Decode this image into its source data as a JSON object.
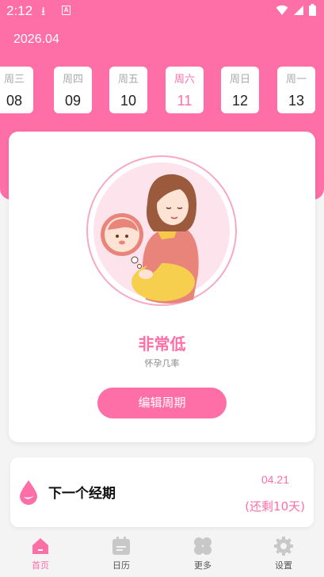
{
  "status_bar": {
    "time": "2:12"
  },
  "header": {
    "month": "2026.04"
  },
  "week": [
    {
      "name": "周三",
      "day": "08",
      "selected": false
    },
    {
      "name": "周四",
      "day": "09",
      "selected": false
    },
    {
      "name": "周五",
      "day": "10",
      "selected": false
    },
    {
      "name": "周六",
      "day": "11",
      "selected": true
    },
    {
      "name": "周日",
      "day": "12",
      "selected": false
    },
    {
      "name": "周一",
      "day": "13",
      "selected": false
    }
  ],
  "main": {
    "level": "非常低",
    "level_caption": "怀孕几率",
    "edit_label": "编辑周期"
  },
  "next_period": {
    "title": "下一个经期",
    "date": "04.21",
    "remaining": "(还剩10天)"
  },
  "nav": [
    {
      "label": "首页",
      "icon": "home-icon",
      "active": true
    },
    {
      "label": "日历",
      "icon": "calendar-icon",
      "active": false
    },
    {
      "label": "更多",
      "icon": "more-icon",
      "active": false
    },
    {
      "label": "设置",
      "icon": "gear-icon",
      "active": false
    }
  ],
  "colors": {
    "accent": "#fe6ea7",
    "background": "#f4f4f4",
    "card": "#ffffff"
  }
}
